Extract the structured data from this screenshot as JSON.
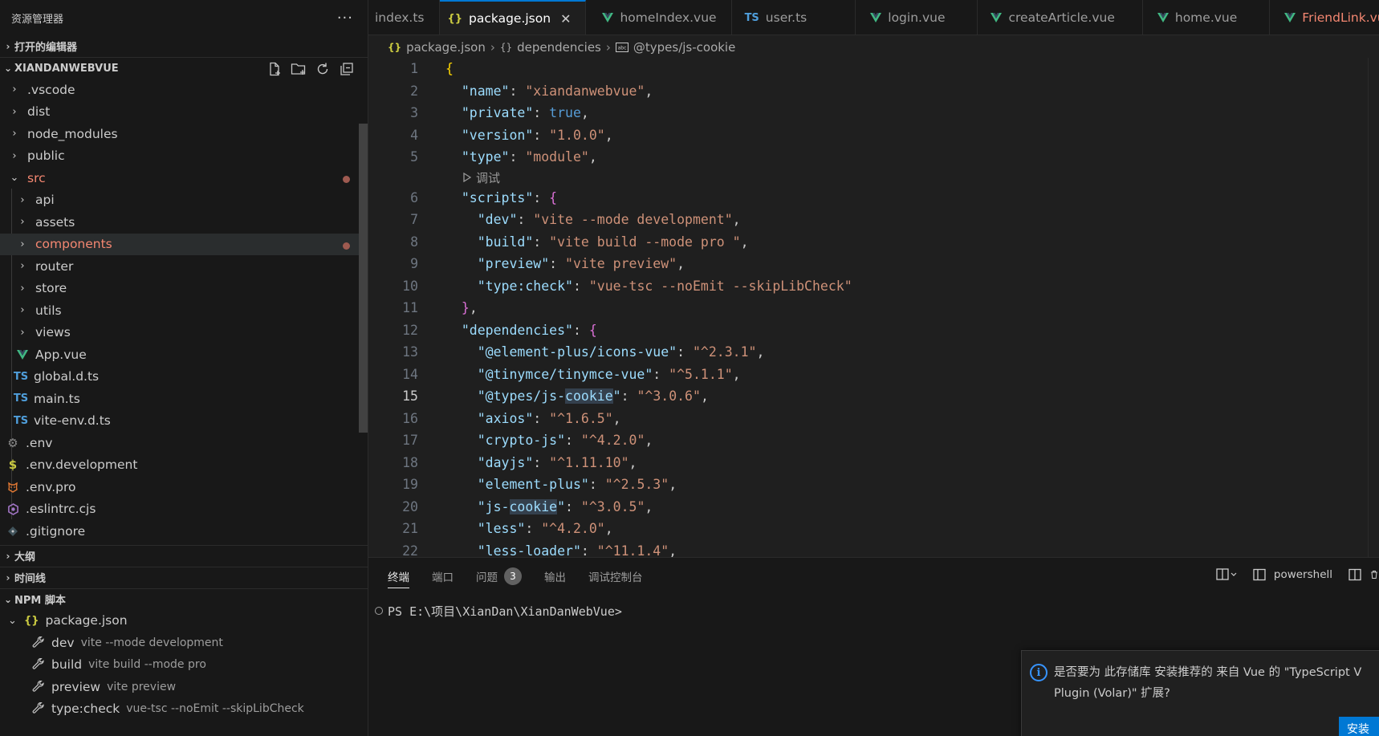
{
  "sidebar": {
    "title": "资源管理器",
    "more": "···",
    "open_editors": "打开的编辑器",
    "project": "XIANDANWEBVUE",
    "tree": [
      {
        "label": ".vscode",
        "kind": "folder"
      },
      {
        "label": "dist",
        "kind": "folder"
      },
      {
        "label": "node_modules",
        "kind": "folder"
      },
      {
        "label": "public",
        "kind": "folder"
      },
      {
        "label": "src",
        "kind": "folder-open"
      },
      {
        "label": "api",
        "kind": "folder"
      },
      {
        "label": "assets",
        "kind": "folder"
      },
      {
        "label": "components",
        "kind": "folder"
      },
      {
        "label": "router",
        "kind": "folder"
      },
      {
        "label": "store",
        "kind": "folder"
      },
      {
        "label": "utils",
        "kind": "folder"
      },
      {
        "label": "views",
        "kind": "folder"
      },
      {
        "label": "App.vue",
        "kind": "vue"
      },
      {
        "label": "global.d.ts",
        "kind": "ts"
      },
      {
        "label": "main.ts",
        "kind": "ts"
      },
      {
        "label": "vite-env.d.ts",
        "kind": "ts"
      },
      {
        "label": ".env",
        "kind": "gear"
      },
      {
        "label": ".env.development",
        "kind": "dollar"
      },
      {
        "label": ".env.pro",
        "kind": "tiger"
      },
      {
        "label": ".eslintrc.cjs",
        "kind": "eslint"
      },
      {
        "label": ".gitignore",
        "kind": "git"
      }
    ],
    "ts_icon": "TS",
    "outline": "大纲",
    "timeline": "时间线",
    "npm": "NPM 脚本",
    "npm_file": "package.json",
    "scripts": [
      {
        "name": "dev",
        "cmd": "vite --mode development"
      },
      {
        "name": "build",
        "cmd": "vite build --mode pro"
      },
      {
        "name": "preview",
        "cmd": "vite preview"
      },
      {
        "name": "type:check",
        "cmd": "vue-tsc --noEmit --skipLibCheck"
      }
    ]
  },
  "tabs": [
    {
      "label": "index.ts",
      "icon": "none"
    },
    {
      "label": "package.json",
      "icon": "braces",
      "active": true
    },
    {
      "label": "homeIndex.vue",
      "icon": "vue"
    },
    {
      "label": "user.ts",
      "icon": "ts"
    },
    {
      "label": "login.vue",
      "icon": "vue"
    },
    {
      "label": "createArticle.vue",
      "icon": "vue"
    },
    {
      "label": "home.vue",
      "icon": "vue"
    },
    {
      "label": "FriendLink.vue",
      "icon": "vue",
      "modified": true
    }
  ],
  "breadcrumb": {
    "file": "package.json",
    "section": "dependencies",
    "item": "@types/js-cookie"
  },
  "code": {
    "codelens": "调试",
    "current_line": 15,
    "lines": [
      {
        "n": 1,
        "t": "{"
      },
      {
        "n": 2,
        "t": "  \"name\": \"xiandanwebvue\","
      },
      {
        "n": 3,
        "t": "  \"private\": true,"
      },
      {
        "n": 4,
        "t": "  \"version\": \"1.0.0\","
      },
      {
        "n": 5,
        "t": "  \"type\": \"module\","
      },
      {
        "n": 6,
        "t": "  \"scripts\": {"
      },
      {
        "n": 7,
        "t": "    \"dev\": \"vite --mode development\","
      },
      {
        "n": 8,
        "t": "    \"build\": \"vite build --mode pro \","
      },
      {
        "n": 9,
        "t": "    \"preview\": \"vite preview\","
      },
      {
        "n": 10,
        "t": "    \"type:check\": \"vue-tsc --noEmit --skipLibCheck\""
      },
      {
        "n": 11,
        "t": "  },"
      },
      {
        "n": 12,
        "t": "  \"dependencies\": {"
      },
      {
        "n": 13,
        "t": "    \"@element-plus/icons-vue\": \"^2.3.1\","
      },
      {
        "n": 14,
        "t": "    \"@tinymce/tinymce-vue\": \"^5.1.1\","
      },
      {
        "n": 15,
        "t": "    \"@types/js-cookie\": \"^3.0.6\","
      },
      {
        "n": 16,
        "t": "    \"axios\": \"^1.6.5\","
      },
      {
        "n": 17,
        "t": "    \"crypto-js\": \"^4.2.0\","
      },
      {
        "n": 18,
        "t": "    \"dayjs\": \"^1.11.10\","
      },
      {
        "n": 19,
        "t": "    \"element-plus\": \"^2.5.3\","
      },
      {
        "n": 20,
        "t": "    \"js-cookie\": \"^3.0.5\","
      },
      {
        "n": 21,
        "t": "    \"less\": \"^4.2.0\","
      },
      {
        "n": 22,
        "t": "    \"less-loader\": \"^11.1.4\","
      }
    ]
  },
  "panel": {
    "tabs": [
      "终端",
      "端口",
      "问题",
      "输出",
      "调试控制台"
    ],
    "problems_count": "3",
    "shell": "powershell",
    "prompt": "PS E:\\项目\\XianDan\\XianDanWebVue>"
  },
  "toast": {
    "line1": "是否要为 此存储库 安装推荐的 来自 Vue 的 \"TypeScript V",
    "line2": "Plugin (Volar)\" 扩展?",
    "button": "安装"
  },
  "colors": {
    "accent": "#0078d4",
    "modified": "#f48771",
    "vue": "#41b883",
    "ts": "#4f9edb"
  }
}
